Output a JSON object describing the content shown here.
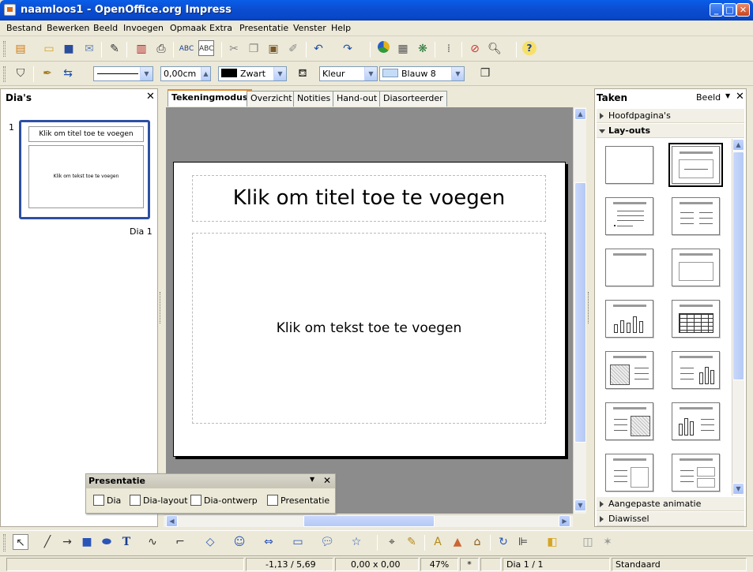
{
  "window": {
    "title": "naamloos1 - OpenOffice.org Impress"
  },
  "menu": [
    "Bestand",
    "Bewerken",
    "Beeld",
    "Invoegen",
    "Opmaak",
    "Extra",
    "Presentatie",
    "Venster",
    "Help"
  ],
  "line_toolbar": {
    "line_width": "0,00cm",
    "line_color": "Zwart",
    "fill_type": "Kleur",
    "fill_color": "Blauw 8",
    "line_color_hex": "#000000",
    "fill_color_hex": "#c5dcf9"
  },
  "slides_panel": {
    "title": "Dia's",
    "close": "✕",
    "thumb_index": "1",
    "thumb_title": "Klik om titel toe te voegen",
    "thumb_text": "Klik om tekst toe te voegen",
    "thumb_label": "Dia 1"
  },
  "tabs": [
    "Tekeningmodus",
    "Overzicht",
    "Notities",
    "Hand-out",
    "Diasorteerder"
  ],
  "slide": {
    "title_placeholder": "Klik om titel toe te voegen",
    "text_placeholder": "Klik om tekst toe te voegen"
  },
  "tasks": {
    "title": "Taken",
    "view_menu": "Beeld",
    "close": "✕",
    "sections": {
      "masters": "Hoofdpagina's",
      "layouts": "Lay-outs",
      "custom_animation": "Aangepaste animatie",
      "transition": "Diawissel"
    }
  },
  "presentation_bar": {
    "title": "Presentatie",
    "items": [
      "Dia",
      "Dia-layout",
      "Dia-ontwerp",
      "Presentatie"
    ]
  },
  "status": {
    "position": "-1,13 / 5,69",
    "size": "0,00 x 0,00",
    "zoom": "47%",
    "modified": "*",
    "page": "Dia 1 / 1",
    "style": "Standaard"
  }
}
